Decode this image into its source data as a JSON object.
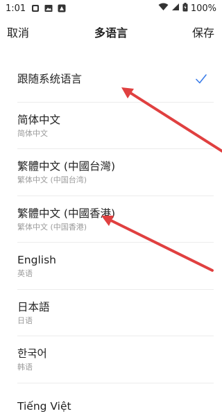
{
  "status_bar": {
    "time": "1:01",
    "battery": "100%"
  },
  "nav": {
    "cancel": "取消",
    "title": "多语言",
    "save": "保存"
  },
  "languages": [
    {
      "name": "跟随系统语言",
      "sub": "",
      "selected": true
    },
    {
      "name": "简体中文",
      "sub": "简体中文",
      "selected": false
    },
    {
      "name": "繁體中文 (中國台灣)",
      "sub": "繁体中文 (中国台湾)",
      "selected": false
    },
    {
      "name": "繁體中文 (中國香港)",
      "sub": "繁体中文 (中国香港)",
      "selected": false
    },
    {
      "name": "English",
      "sub": "英语",
      "selected": false
    },
    {
      "name": "日本語",
      "sub": "日语",
      "selected": false
    },
    {
      "name": "한국어",
      "sub": "韩语",
      "selected": false
    },
    {
      "name": "Tiếng Việt",
      "sub": "",
      "selected": false
    }
  ],
  "colors": {
    "check": "#3b7de9",
    "annotation": "#e04040"
  }
}
